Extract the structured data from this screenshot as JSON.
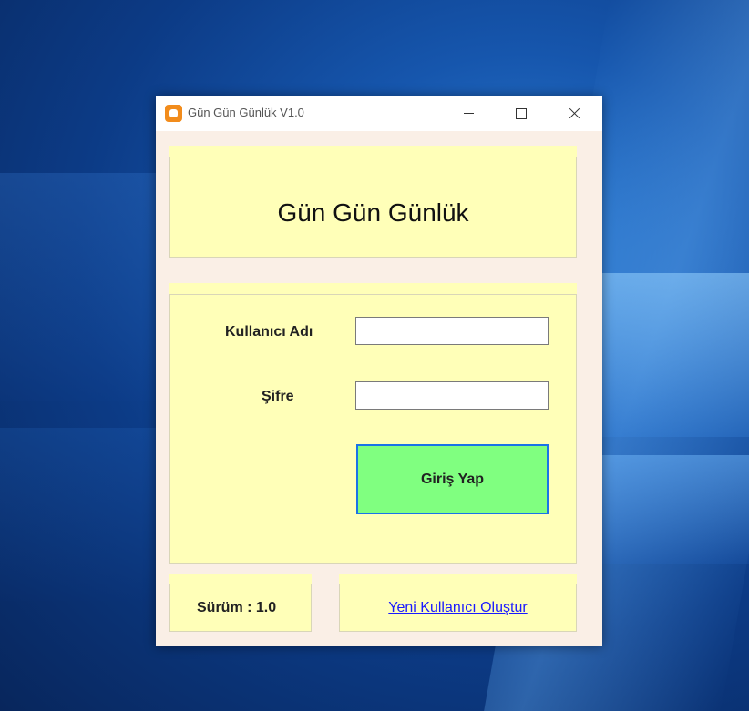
{
  "window": {
    "title": "Gün Gün Günlük V1.0"
  },
  "header": {
    "heading": "Gün Gün Günlük"
  },
  "form": {
    "username_label": "Kullanıcı Adı",
    "username_value": "",
    "password_label": "Şifre",
    "password_value": "",
    "login_label": "Giriş Yap"
  },
  "footer": {
    "version_text": "Sürüm : 1.0",
    "new_user_link": "Yeni Kullanıcı Oluştur"
  },
  "colors": {
    "panel_bg": "#ffffb8",
    "window_bg": "#faefe6",
    "login_button_bg": "#80ff80",
    "login_button_border": "#1a73e8",
    "link": "#1a1aff"
  },
  "icons": {
    "app": "app-icon",
    "minimize": "minimize-icon",
    "maximize": "maximize-icon",
    "close": "close-icon"
  }
}
